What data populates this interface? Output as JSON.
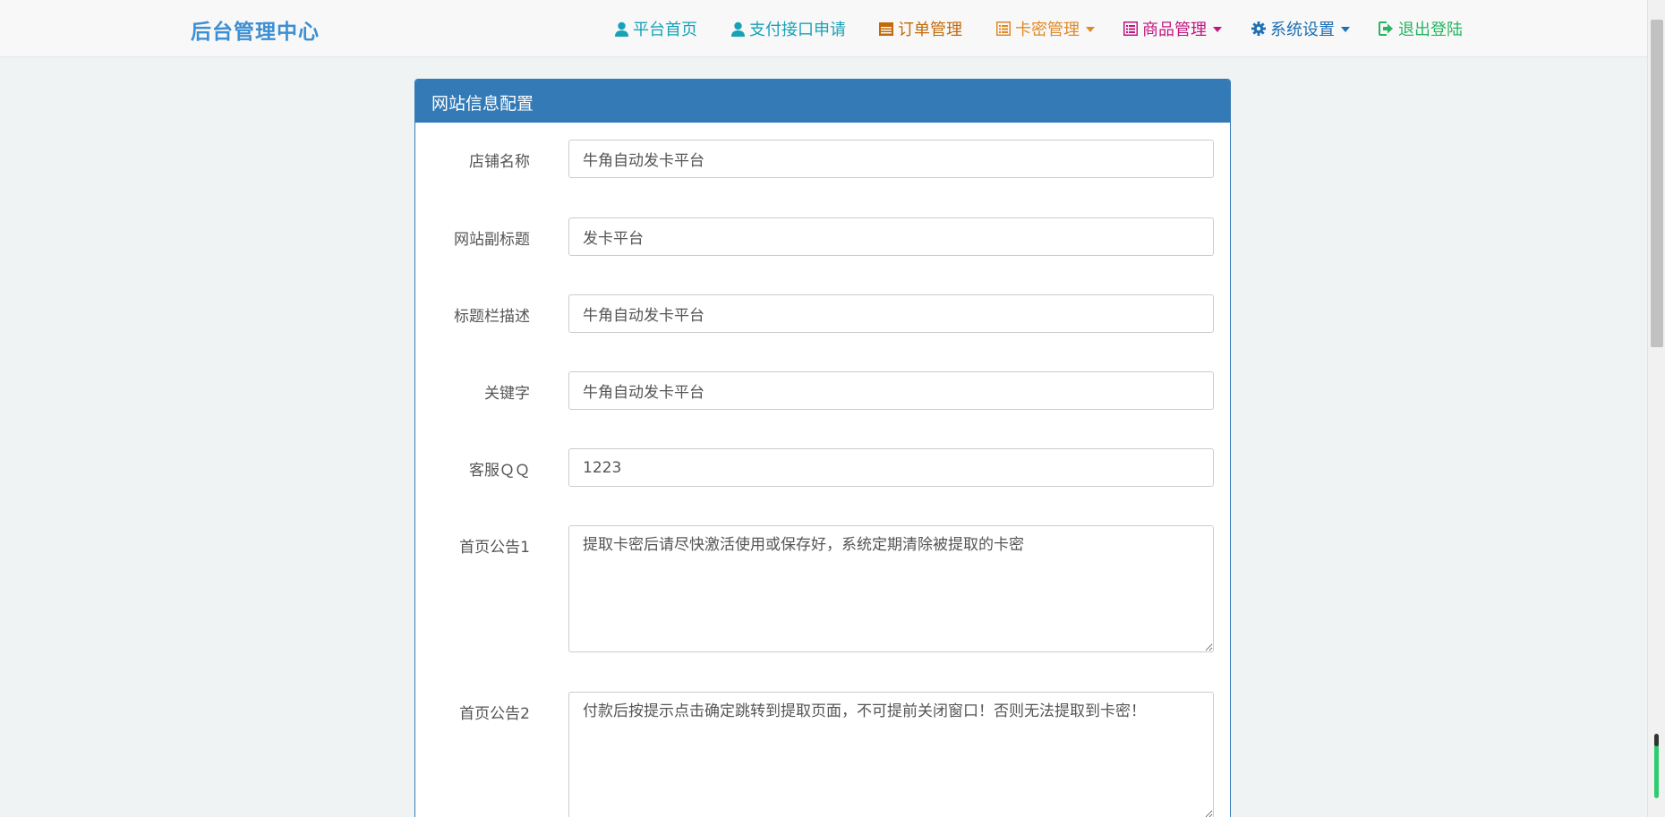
{
  "brand": "后台管理中心",
  "colors": {
    "brand": "#3d8fd4",
    "nav_teal": "#17a2b8",
    "nav_orange": "#c26a08",
    "nav_amber": "#e08a26",
    "nav_pink": "#c0167f",
    "nav_blue": "#1e6fb3",
    "nav_green": "#28b463",
    "panel_header": "#337ab7"
  },
  "nav": [
    {
      "label": "平台首页",
      "icon": "user-icon",
      "has_caret": false
    },
    {
      "label": "支付接口申请",
      "icon": "user-icon",
      "has_caret": false
    },
    {
      "label": "订单管理",
      "icon": "calendar-icon",
      "has_caret": false
    },
    {
      "label": "卡密管理",
      "icon": "list-alt-icon",
      "has_caret": true
    },
    {
      "label": "商品管理",
      "icon": "list-alt-icon",
      "has_caret": true
    },
    {
      "label": "系统设置",
      "icon": "gear-icon",
      "has_caret": true
    },
    {
      "label": "退出登陆",
      "icon": "logout-icon",
      "has_caret": false
    }
  ],
  "panel": {
    "title": "网站信息配置",
    "fields": [
      {
        "label": "店铺名称",
        "value": "牛角自动发卡平台",
        "type": "text"
      },
      {
        "label": "网站副标题",
        "value": "发卡平台",
        "type": "text"
      },
      {
        "label": "标题栏描述",
        "value": "牛角自动发卡平台",
        "type": "text"
      },
      {
        "label": "关键字",
        "value": "牛角自动发卡平台",
        "type": "text"
      },
      {
        "label": "客服ＱＱ",
        "value": "1223",
        "type": "text"
      },
      {
        "label": "首页公告1",
        "value": "提取卡密后请尽快激活使用或保存好，系统定期清除被提取的卡密",
        "type": "textarea"
      },
      {
        "label": "首页公告2",
        "value": "付款后按提示点击确定跳转到提取页面，不可提前关闭窗口！否则无法提取到卡密！",
        "type": "textarea"
      }
    ]
  }
}
